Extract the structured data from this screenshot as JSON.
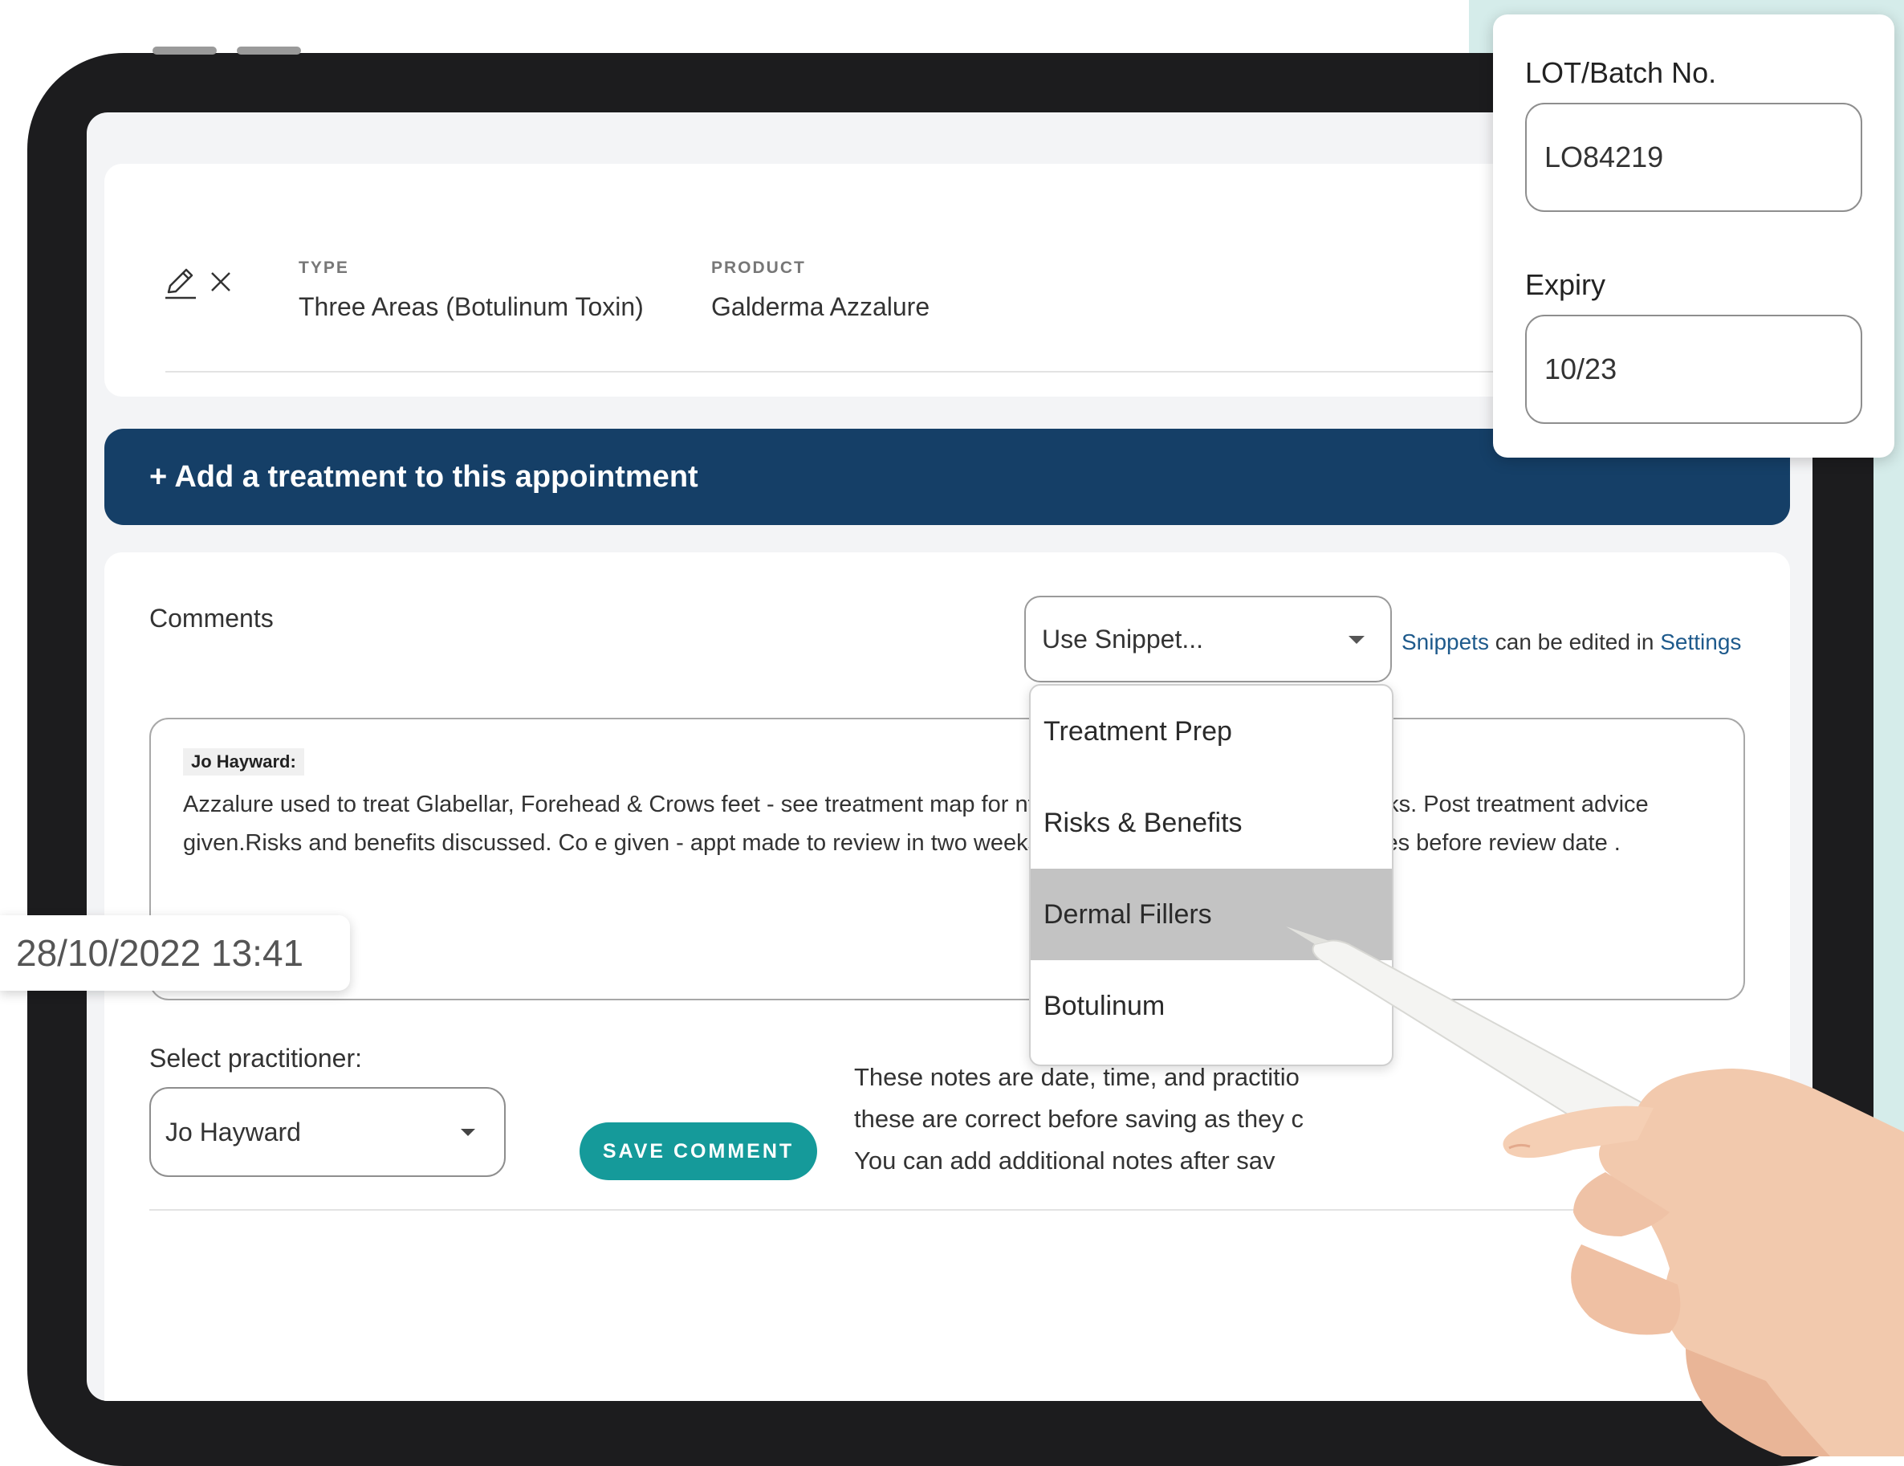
{
  "treatment": {
    "type_label": "TYPE",
    "type_value": "Three Areas (Botulinum Toxin)",
    "product_label": "PRODUCT",
    "product_value": "Galderma Azzalure"
  },
  "add_treatment_label": "+ Add a treatment to this appointment",
  "comments": {
    "label": "Comments",
    "snippet_placeholder": "Use Snippet...",
    "snippet_note_link": "Snippets",
    "snippet_note_mid": " can be edited in ",
    "snippet_note_settings": "Settings",
    "author": "Jo Hayward:",
    "text": "Azzalure used to treat Glabellar, Forehead & Crows feet - see treatment map for nt, client happy. Will review in 2 weeks. Post treatment advice given.Risks and benefits discussed. Co e given - appt made to review in two weeks - told client to call me if any queries before review date ."
  },
  "snippet_menu": {
    "items": [
      "Treatment Prep",
      "Risks & Benefits",
      "Dermal Fillers",
      "Botulinum"
    ],
    "selected_index": 2
  },
  "practitioner": {
    "label": "Select practitioner:",
    "value": "Jo Hayward"
  },
  "save_comment_label": "SAVE COMMENT",
  "info_lines": [
    "These notes are date, time, and practitio",
    "these are correct before saving as they c",
    "You can add additional notes after sav"
  ],
  "lot": {
    "batch_label": "LOT/Batch No.",
    "batch_value": "LO84219",
    "expiry_label": "Expiry",
    "expiry_value": "10/23"
  },
  "timestamp": "28/10/2022 13:41",
  "colors": {
    "primary_navy": "#153f67",
    "accent_teal": "#159a9a",
    "link_blue": "#1e5a8c",
    "background_teal": "#d5ecea"
  },
  "icons": [
    "edit-pencil-icon",
    "close-icon",
    "chevron-down-icon"
  ]
}
